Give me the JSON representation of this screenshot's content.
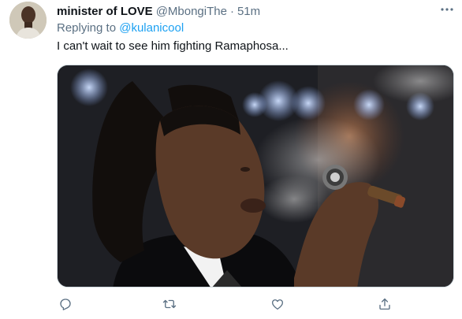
{
  "tweet": {
    "display_name": "minister of LOVE",
    "handle": "@MbongiThe",
    "separator": "·",
    "time": "51m",
    "replying_to_prefix": "Replying to",
    "replying_to_handle": "@kulanicool",
    "text": "I can't wait to see him fighting Ramaphosa...",
    "media_description": "photo",
    "icons": {
      "more": "more-horizontal-icon",
      "reply": "reply-icon",
      "retweet": "retweet-icon",
      "like": "heart-icon",
      "share": "share-icon"
    },
    "colors": {
      "secondary_text": "#5b7083",
      "link": "#1da1f2",
      "primary_text": "#0f1419",
      "border": "#cfd9de"
    }
  }
}
